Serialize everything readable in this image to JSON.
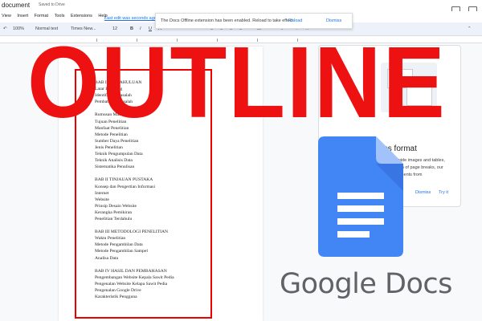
{
  "window": {
    "doc_title": "document",
    "saved_status": "Saved to Drive"
  },
  "menu": {
    "items": [
      "View",
      "Insert",
      "Format",
      "Tools",
      "Extensions",
      "Help"
    ],
    "last_edit": "Last edit was seconds ago"
  },
  "toolbar": {
    "zoom": "100%",
    "style": "Normal text",
    "font": "Times New...",
    "size": "12",
    "bold": "B",
    "italic": "I",
    "underline": "U",
    "text_color": "A"
  },
  "notification": {
    "text": "The Docs Offline extension has been enabled. Reload to take effect.",
    "reload": "Reload",
    "dismiss": "Dismiss"
  },
  "document": {
    "lines": [
      "BAB I PENDAHULUAN",
      "Latar Belakang",
      "Identifikasi Masalah",
      "Pembatasan Masalah",
      "",
      "Rumusan Masalah",
      "Tujuan Penelitian",
      "Manfaat Penelitian",
      "Metode Penelitian",
      "Sumber Daya Penelitian",
      "Jenis Penelitian",
      "Teknik Pengumpulan Data",
      "Teknik Analisis Data",
      "Sistematika Penulisan",
      "",
      "BAB II TINJAUAN PUSTAKA",
      "Konsep dan Pengertian Informasi",
      "Internet",
      "Website",
      "Prinsip Desain Website",
      "Kerangka Pemikiran",
      "Penelitian Terdahulu",
      "",
      "BAB III METODOLOGI PENELITIAN",
      "Waktu Penelitian",
      "Metode Pengambilan Data",
      "Metode Pengambilan Sampel",
      "Analisa Data",
      "",
      "BAB IV HASIL DAN PEMBAHASAN",
      "Pengembangan Website Kepala Sawit Pedia",
      "Pengenalan Website Kelapa Sawit Pedia",
      "Pengenalan Google Drive",
      "Karakteristik Pengguna"
    ]
  },
  "side_panel": {
    "title": "less format",
    "description": "ide wide images and tables, ruption of page breaks, our documents from",
    "dismiss": "Dismiss",
    "try": "Try it"
  },
  "overlay": {
    "headline": "OUTLINE",
    "headline_color": "#ee1111",
    "outline_box_color": "#ee0000"
  },
  "brand": {
    "name": "Google Docs",
    "logo_color": "#4285f4"
  }
}
